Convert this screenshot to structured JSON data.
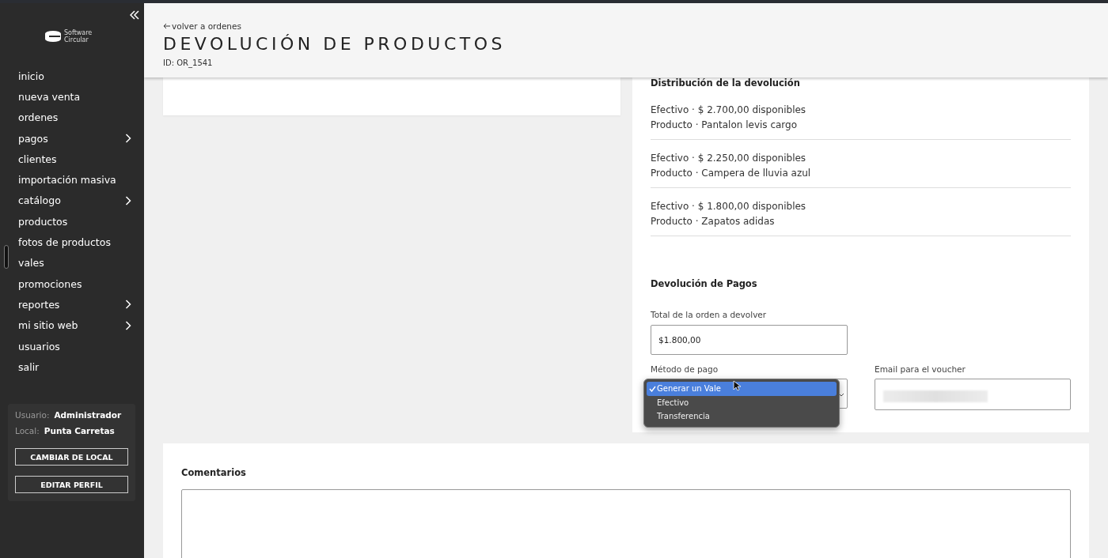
{
  "sidebar": {
    "brand": [
      "Software",
      "Circular"
    ],
    "items": [
      {
        "label": "inicio",
        "has_submenu": false
      },
      {
        "label": "nueva venta",
        "has_submenu": false
      },
      {
        "label": "ordenes",
        "has_submenu": false
      },
      {
        "label": "pagos",
        "has_submenu": true
      },
      {
        "label": "clientes",
        "has_submenu": false
      },
      {
        "label": "importación masiva",
        "has_submenu": false
      },
      {
        "label": "catálogo",
        "has_submenu": true
      },
      {
        "label": "productos",
        "has_submenu": false
      },
      {
        "label": "fotos de productos",
        "has_submenu": false
      },
      {
        "label": "vales",
        "has_submenu": false
      },
      {
        "label": "promociones",
        "has_submenu": false
      },
      {
        "label": "reportes",
        "has_submenu": true
      },
      {
        "label": "mi sitio web",
        "has_submenu": true
      },
      {
        "label": "usuarios",
        "has_submenu": false
      },
      {
        "label": "salir",
        "has_submenu": false
      }
    ],
    "user": {
      "user_label": "Usuario:",
      "user_value": "Administrador",
      "local_label": "Local:",
      "local_value": "Punta Carretas"
    },
    "buttons": [
      "CAMBIAR DE LOCAL",
      "EDITAR PERFIL"
    ]
  },
  "header": {
    "back_link": "volver a ordenes",
    "title": "DEVOLUCIÓN DE PRODUCTOS",
    "order_id": "ID: OR_1541"
  },
  "distribution": {
    "title": "Distribución de la devolución",
    "rows": [
      {
        "line_1": "Efectivo · $ 2.700,00 disponibles",
        "line_2": "Producto · Pantalon levis cargo"
      },
      {
        "line_1": "Efectivo · $ 2.250,00 disponibles",
        "line_2": "Producto · Campera de lluvia azul"
      },
      {
        "line_1": "Efectivo · $ 1.800,00 disponibles",
        "line_2": "Producto · Zapatos adidas"
      }
    ]
  },
  "payments": {
    "title": "Devolución de Pagos",
    "total_label": "Total de la orden a devolver",
    "total_value": "$1.800,00",
    "method_label": "Método de pago",
    "method_options": [
      {
        "label": "Generar un Vale",
        "selected": true
      },
      {
        "label": "Efectivo",
        "selected": false
      },
      {
        "label": "Transferencia",
        "selected": false
      }
    ],
    "email_label": "Email para el voucher"
  },
  "comments": {
    "title": "Comentarios"
  }
}
